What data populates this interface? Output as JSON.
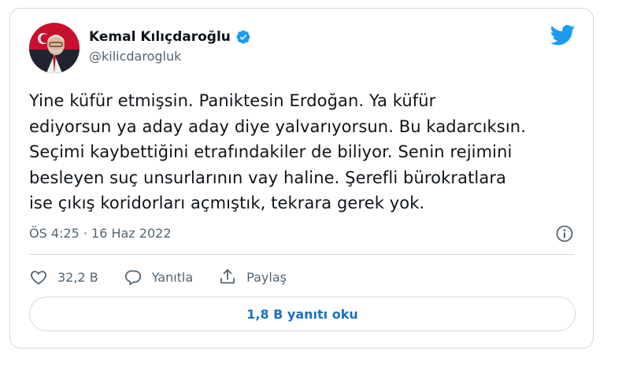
{
  "author": {
    "name": "Kemal Kılıçdaroğlu",
    "handle": "@kilicdarogluk",
    "verified": true
  },
  "tweet": {
    "text_lines": [
      "Yine küfür etmişsin. Paniktesin Erdoğan. Ya küfür",
      "ediyorsun ya aday aday diye yalvarıyorsun. Bu kadarcıksın.",
      "Seçimi kaybettiğini etrafındakiler de biliyor. Senin rejimini",
      "besleyen suç unsurlarının vay haline. Şerefli bürokratlara",
      "ise çıkış koridorları açmıştık, tekrara gerek yok."
    ],
    "timestamp": "ÖS 4:25 · 16 Haz 2022"
  },
  "actions": {
    "like_count": "32,2 B",
    "reply_label": "Yanıtla",
    "share_label": "Paylaş"
  },
  "read_replies_label": "1,8 B yanıtı oku",
  "icons": {
    "brand": "twitter-bird-icon",
    "verified": "verified-badge-icon",
    "info": "info-icon",
    "like": "heart-icon",
    "reply": "speech-bubble-icon",
    "share": "share-icon"
  },
  "colors": {
    "twitter_blue": "#1d9bf0",
    "link_blue": "#1d6fbf",
    "text": "#0f1419",
    "muted": "#536471",
    "border": "#cfd9de"
  }
}
